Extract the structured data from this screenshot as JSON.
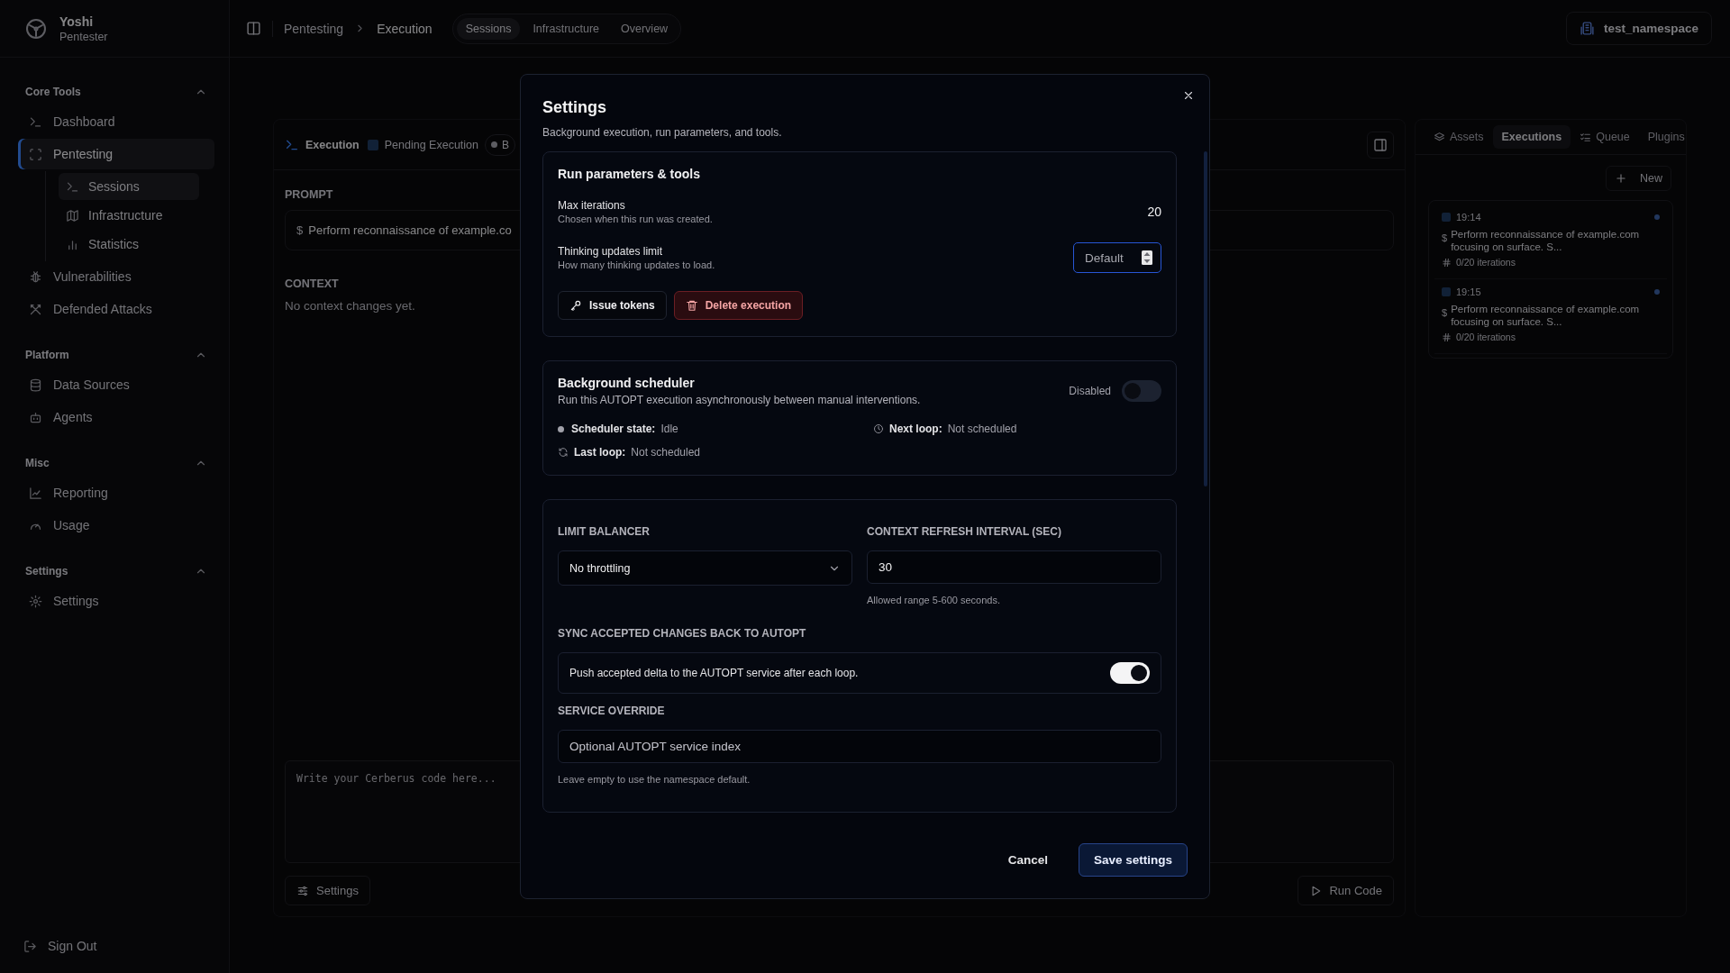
{
  "user": {
    "name": "Yoshi",
    "role": "Pentester"
  },
  "sidebar": {
    "sections": [
      {
        "title": "Core Tools",
        "expanded": true,
        "items": [
          {
            "label": "Dashboard",
            "selected": false
          },
          {
            "label": "Pentesting",
            "selected": true,
            "children": [
              {
                "label": "Sessions",
                "selected": true
              },
              {
                "label": "Infrastructure",
                "selected": false
              },
              {
                "label": "Statistics",
                "selected": false
              }
            ]
          },
          {
            "label": "Vulnerabilities",
            "selected": false
          },
          {
            "label": "Defended Attacks",
            "selected": false
          }
        ]
      },
      {
        "title": "Platform",
        "expanded": true,
        "items": [
          {
            "label": "Data Sources",
            "selected": false
          },
          {
            "label": "Agents",
            "selected": false
          }
        ]
      },
      {
        "title": "Misc",
        "expanded": true,
        "items": [
          {
            "label": "Reporting",
            "selected": false
          },
          {
            "label": "Usage",
            "selected": false
          }
        ]
      },
      {
        "title": "Settings",
        "expanded": true,
        "items": [
          {
            "label": "Settings",
            "selected": false
          }
        ]
      }
    ],
    "sign_out": "Sign Out"
  },
  "topbar": {
    "breadcrumb": [
      "Pentesting",
      "Execution"
    ],
    "view_tabs": [
      {
        "label": "Sessions",
        "selected": true
      },
      {
        "label": "Infrastructure",
        "selected": false
      },
      {
        "label": "Overview",
        "selected": false
      }
    ],
    "namespace": "test_namespace"
  },
  "execution": {
    "title": "Execution",
    "status": "Pending Execution",
    "chip": "B",
    "prompt_label": "PROMPT",
    "prompt_symbol": "$",
    "prompt": "Perform reconnaissance of example.co",
    "context_label": "CONTEXT",
    "context_empty": "No context changes yet.",
    "editor_placeholder": "Write your Cerberus code here...",
    "settings_button": "Settings",
    "run_button": "Run Code"
  },
  "right_panel": {
    "tabs": [
      {
        "label": "Assets",
        "selected": false
      },
      {
        "label": "Executions",
        "selected": true
      },
      {
        "label": "Queue",
        "selected": false
      },
      {
        "label": "Plugins",
        "selected": false
      }
    ],
    "new_button": "New",
    "executions": [
      {
        "time": "19:14",
        "symbol": "$",
        "prompt": "Perform reconnaissance of example.com focusing on surface. S...",
        "iterations": "0/20 iterations"
      },
      {
        "time": "19:15",
        "symbol": "$",
        "prompt": "Perform reconnaissance of example.com focusing on surface. S...",
        "iterations": "0/20 iterations"
      }
    ]
  },
  "modal": {
    "title": "Settings",
    "subtitle": "Background execution, run parameters, and tools.",
    "run_parameters": {
      "title": "Run parameters & tools",
      "max_iterations": {
        "label": "Max iterations",
        "hint": "Chosen when this run was created.",
        "value": "20"
      },
      "thinking_limit": {
        "label": "Thinking updates limit",
        "hint": "How many thinking updates to load.",
        "placeholder": "Default"
      },
      "buttons": [
        {
          "label": "Issue tokens",
          "kind": "default"
        },
        {
          "label": "Delete execution",
          "kind": "danger"
        }
      ]
    },
    "scheduler": {
      "title": "Background scheduler",
      "description": "Run this AUTOPT execution asynchronously between manual interventions.",
      "toggle_label": "Disabled",
      "on": false,
      "stats": [
        {
          "label": "Scheduler state:",
          "value": "Idle"
        },
        {
          "label": "Next loop:",
          "value": "Not scheduled"
        },
        {
          "label": "Last loop:",
          "value": "Not scheduled"
        }
      ]
    },
    "limit_balancer": {
      "label": "LIMIT BALANCER",
      "value": "No throttling"
    },
    "context_refresh": {
      "label": "CONTEXT REFRESH INTERVAL (SEC)",
      "value": "30",
      "hint": "Allowed range 5-600 seconds."
    },
    "sync": {
      "label": "SYNC ACCEPTED CHANGES BACK TO AUTOPT",
      "description": "Push accepted delta to the AUTOPT service after each loop.",
      "on": true
    },
    "service_override": {
      "label": "SERVICE OVERRIDE",
      "placeholder": "Optional AUTOPT service index",
      "hint": "Leave empty to use the namespace default."
    },
    "cancel": "Cancel",
    "save": "Save settings"
  }
}
